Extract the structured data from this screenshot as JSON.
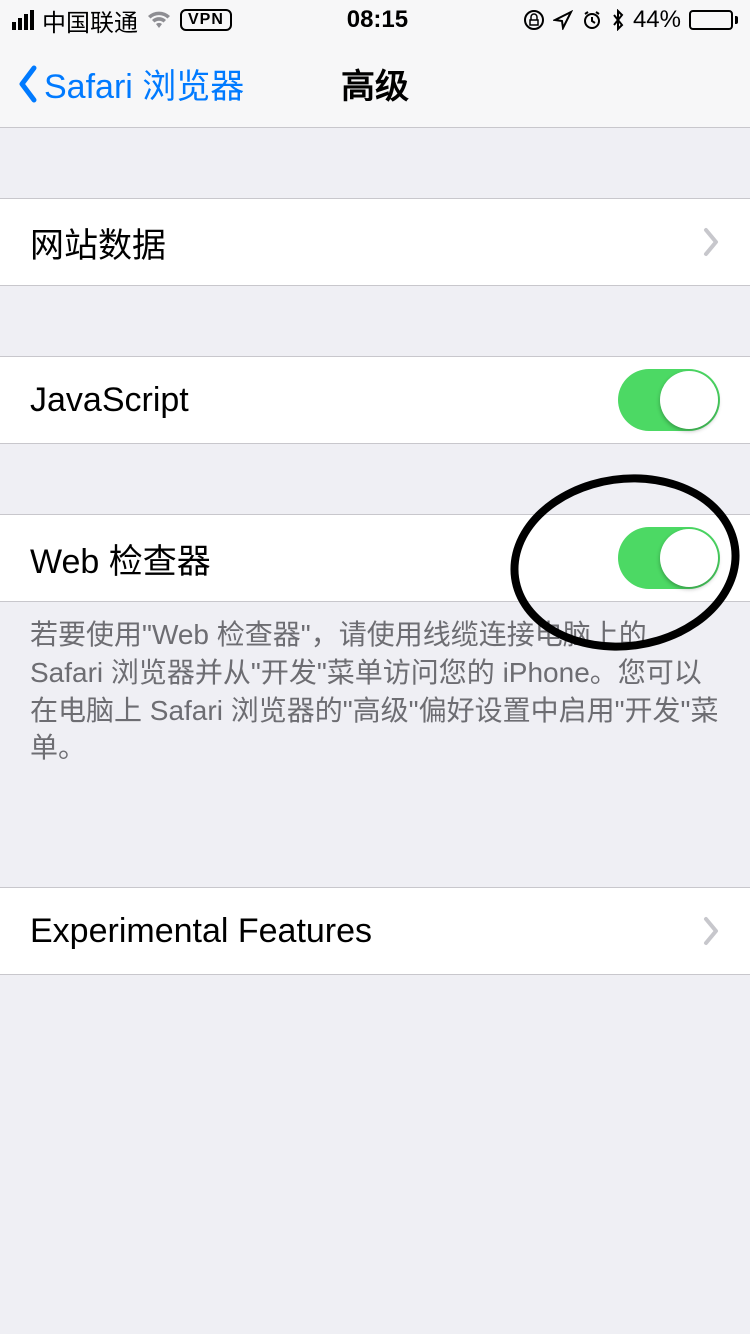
{
  "status_bar": {
    "carrier": "中国联通",
    "vpn_label": "VPN",
    "time": "08:15",
    "battery_percent": "44%",
    "battery_fill_pct": 44
  },
  "nav": {
    "back_label": "Safari 浏览器",
    "title": "高级"
  },
  "rows": {
    "website_data": "网站数据",
    "javascript": "JavaScript",
    "web_inspector": "Web 检查器",
    "experimental": "Experimental Features"
  },
  "toggles": {
    "javascript_on": true,
    "web_inspector_on": true
  },
  "footer": {
    "web_inspector_help": "若要使用\"Web 检查器\"，请使用线缆连接电脑上的 Safari 浏览器并从\"开发\"菜单访问您的 iPhone。您可以在电脑上 Safari 浏览器的\"高级\"偏好设置中启用\"开发\"菜单。"
  },
  "colors": {
    "tint": "#007aff",
    "toggle_on": "#4cd964",
    "battery_fill": "#ffcc00"
  }
}
